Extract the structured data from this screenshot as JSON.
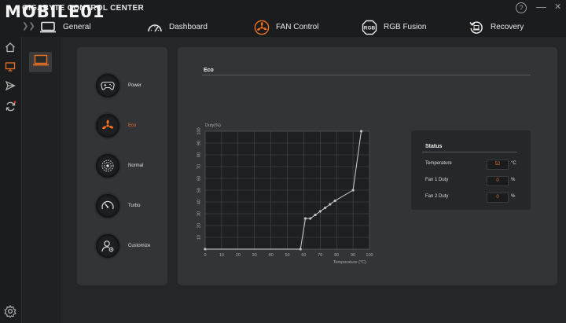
{
  "app": {
    "title": "GIGABYTE CONTROL CENTER",
    "watermark": "MOBILE01",
    "help_label": "?",
    "minimize_label": "—",
    "close_label": "✕"
  },
  "tabs": [
    {
      "label": "General",
      "icon": "laptop-icon"
    },
    {
      "label": "Dashboard",
      "icon": "gauge-icon"
    },
    {
      "label": "FAN Control",
      "icon": "fan-icon",
      "active": true
    },
    {
      "label": "RGB Fusion",
      "icon": "rgb-icon"
    },
    {
      "label": "Recovery",
      "icon": "recovery-icon"
    }
  ],
  "sidebar": {
    "icons": [
      "home-icon",
      "monitor-icon",
      "send-icon",
      "sync-icon",
      "settings-icon"
    ],
    "active": "monitor-icon"
  },
  "modes": [
    {
      "label": "Power",
      "icon": "gamepad-icon"
    },
    {
      "label": "Eco",
      "icon": "fan-icon",
      "active": true
    },
    {
      "label": "Normal",
      "icon": "fan-normal-icon"
    },
    {
      "label": "Turbo",
      "icon": "speedometer-icon"
    },
    {
      "label": "Customize",
      "icon": "user-settings-icon"
    }
  ],
  "panel": {
    "title": "Eco"
  },
  "chart_data": {
    "type": "line",
    "title": "",
    "ylabel": "Duty(%)",
    "xlabel": "Temperature (°C)",
    "xlim": [
      0,
      100
    ],
    "ylim": [
      0,
      100
    ],
    "x_ticks": [
      0,
      10,
      20,
      30,
      40,
      50,
      60,
      70,
      80,
      90,
      100
    ],
    "y_ticks": [
      10,
      20,
      30,
      40,
      50,
      60,
      70,
      80,
      90,
      100
    ],
    "grid": true,
    "series": [
      {
        "x": [
          0,
          58,
          61,
          64,
          67,
          70,
          73,
          76,
          79,
          90,
          95
        ],
        "y": [
          0,
          0,
          26,
          26,
          29,
          32,
          35,
          38,
          41,
          50,
          100
        ]
      }
    ]
  },
  "status": {
    "title": "Status",
    "rows": [
      {
        "label": "Temperature",
        "value": "52",
        "unit": "°C",
        "value_color": "#f07020"
      },
      {
        "label": "Fan 1 Duty",
        "value": "0",
        "unit": "%",
        "value_color": "#f07020"
      },
      {
        "label": "Fan 2 Duty",
        "value": "0",
        "unit": "%",
        "value_color": "#f07020"
      }
    ]
  },
  "colors": {
    "accent": "#f07020",
    "panel": "#333437",
    "background": "#1f2022"
  }
}
